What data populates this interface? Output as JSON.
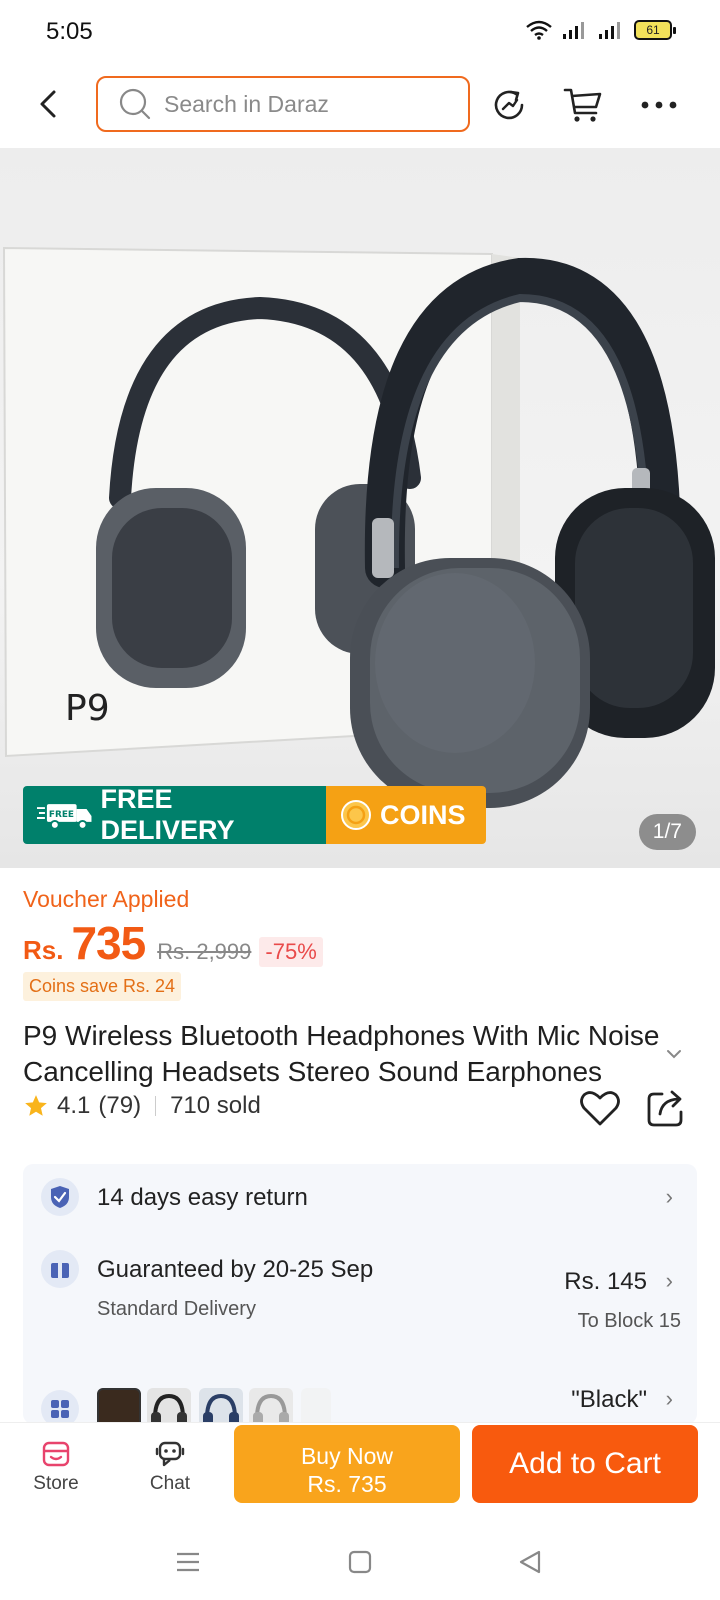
{
  "status_bar": {
    "time": "5:05",
    "battery": "61"
  },
  "header": {
    "search_placeholder": "Search in Daraz"
  },
  "hero": {
    "box_model": "P9",
    "promo_free_delivery": "FREE DELIVERY",
    "promo_free_tag": "FREE",
    "promo_coins": "COINS",
    "page_counter": "1/7"
  },
  "price": {
    "voucher_label": "Voucher Applied",
    "currency": "Rs.",
    "value": "735",
    "original": "Rs. 2,999",
    "discount": "-75%",
    "coins_save": "Coins save Rs. 24"
  },
  "product": {
    "title": "P9 Wireless Bluetooth Headphones With Mic Noise Cancelling Headsets Stereo Sound Earphones",
    "rating": "4.1",
    "rating_count": "(79)",
    "sold": "710 sold"
  },
  "info": {
    "returns": "14 days easy return",
    "delivery_guarantee": "Guaranteed by 20-25 Sep",
    "delivery_type": "Standard Delivery",
    "delivery_price": "Rs. 145",
    "delivery_destination": "To Block 15",
    "variant_selected": "\"Black\""
  },
  "bottom_bar": {
    "store_label": "Store",
    "chat_label": "Chat",
    "buy_now_line1": "Buy Now",
    "buy_now_line2": "Rs. 735",
    "add_to_cart": "Add to Cart"
  },
  "colors": {
    "accent": "#f85a0e",
    "buy_now": "#f9a41c",
    "promo_green": "#00806b"
  }
}
